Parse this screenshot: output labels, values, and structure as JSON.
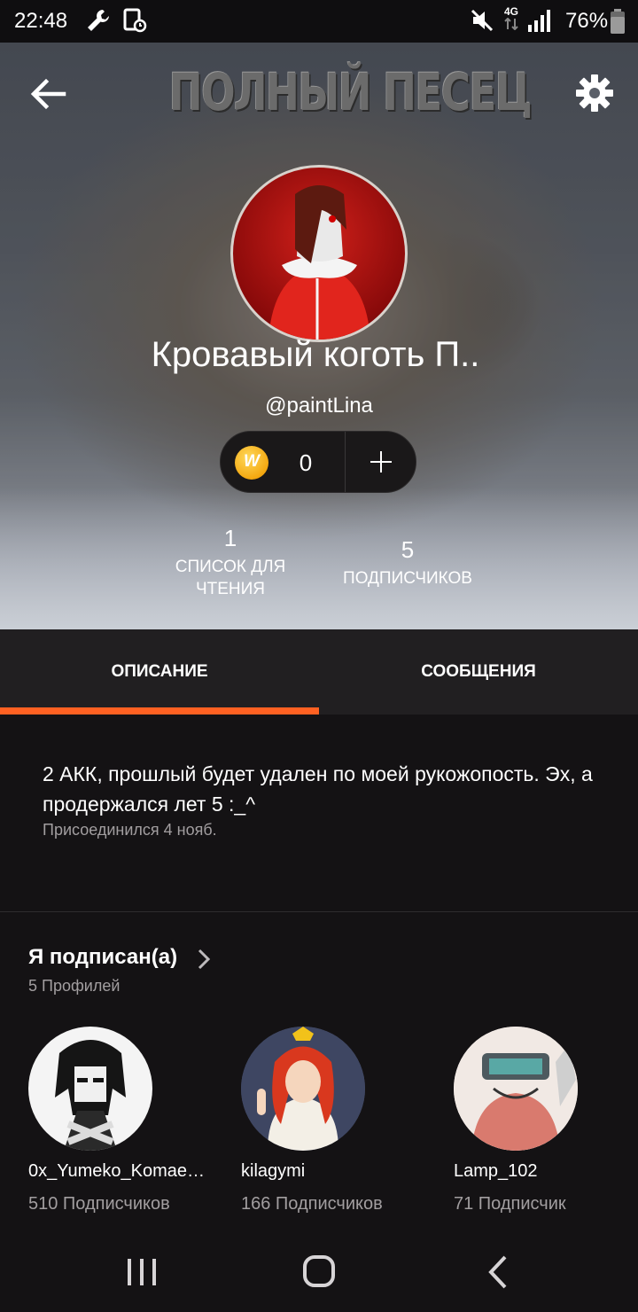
{
  "status_bar": {
    "time": "22:48",
    "network": "4G",
    "battery": "76%",
    "icons": [
      "wrench-icon",
      "screenshot-icon",
      "mute-icon",
      "network-4g-icon",
      "signal-icon",
      "battery-icon"
    ]
  },
  "header": {
    "meme_caption": "ПОЛНЫЙ ПЕСЕЦ",
    "back_icon": "arrow-left-icon",
    "settings_icon": "gear-icon"
  },
  "profile": {
    "name": "Кровавый коготь П..",
    "handle": "@paintLina",
    "coins": "0",
    "coin_symbol": "W",
    "stats": [
      {
        "value": "1",
        "label_line1": "СПИСОК ДЛЯ",
        "label_line2": "ЧТЕНИЯ"
      },
      {
        "value": "5",
        "label_line1": "ПОДПИСЧИКОВ"
      }
    ]
  },
  "tabs": [
    {
      "label": "ОПИСАНИЕ",
      "active": true
    },
    {
      "label": "СООБЩЕНИЯ",
      "active": false
    }
  ],
  "description": {
    "text": "2 АКК, прошлый будет удален по моей рукожопость. Эх, а продержался лет 5 :_^",
    "joined": "Присоединился 4 нояб."
  },
  "following": {
    "title": "Я подписан(а)",
    "count": "5 Профилей",
    "users": [
      {
        "name": "0x_Yumeko_Komaed…",
        "followers": "510 Подписчиков"
      },
      {
        "name": "kilagymi",
        "followers": "166 Подписчиков"
      },
      {
        "name": "Lamp_102",
        "followers": "71 Подписчик"
      }
    ]
  },
  "colors": {
    "accent": "#ff6122",
    "background": "#141214",
    "tab_bar": "#211f21",
    "muted_text": "#a29ea0"
  }
}
